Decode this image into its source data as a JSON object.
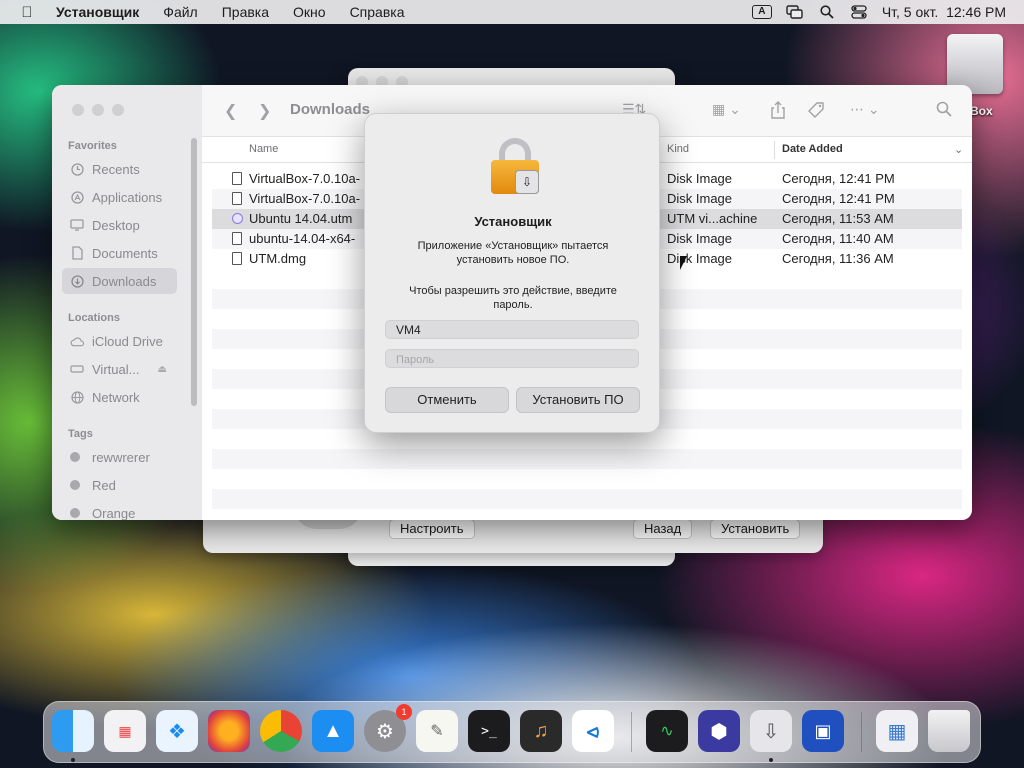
{
  "menubar": {
    "app_name": "Установщик",
    "items": [
      "Файл",
      "Правка",
      "Окно",
      "Справка"
    ],
    "keyboard_indicator": "A",
    "clock": "Чт, 5 окт.  12:46 PM"
  },
  "desktop": {
    "icon_label": "Box"
  },
  "installer_window": {
    "customize_label": "Настроить",
    "back_label": "Назад",
    "install_label": "Установить"
  },
  "finder": {
    "title": "Downloads",
    "sidebar": {
      "favorites_header": "Favorites",
      "favorites": [
        {
          "label": "Recents",
          "icon": "clock-icon"
        },
        {
          "label": "Applications",
          "icon": "applications-icon"
        },
        {
          "label": "Desktop",
          "icon": "desktop-icon"
        },
        {
          "label": "Documents",
          "icon": "document-icon"
        },
        {
          "label": "Downloads",
          "icon": "download-icon"
        }
      ],
      "locations_header": "Locations",
      "locations": [
        {
          "label": "iCloud Drive",
          "icon": "cloud-icon"
        },
        {
          "label": "Virtual...",
          "icon": "disk-icon"
        },
        {
          "label": "Network",
          "icon": "globe-icon"
        }
      ],
      "tags_header": "Tags",
      "tags": [
        {
          "label": "rewwrerer"
        },
        {
          "label": "Red"
        },
        {
          "label": "Orange"
        }
      ]
    },
    "columns": {
      "name": "Name",
      "kind": "Kind",
      "date": "Date Added"
    },
    "rows": [
      {
        "name": "VirtualBox-7.0.10a-",
        "kind": "Disk Image",
        "date": "Сегодня, 12:41 PM"
      },
      {
        "name": "VirtualBox-7.0.10a-",
        "kind": "Disk Image",
        "date": "Сегодня, 12:41 PM"
      },
      {
        "name": "Ubuntu 14.04.utm",
        "kind": "UTM vi...achine",
        "date": "Сегодня, 11:53 AM"
      },
      {
        "name": "ubuntu-14.04-x64-",
        "kind": "Disk Image",
        "date": "Сегодня, 11:40 AM"
      },
      {
        "name": "UTM.dmg",
        "kind": "Disk Image",
        "date": "Сегодня, 11:36 AM"
      }
    ]
  },
  "auth_dialog": {
    "title": "Установщик",
    "message": "Приложение «Установщик» пытается установить новое ПО.",
    "prompt": "Чтобы разрешить это действие, введите пароль.",
    "username_value": "VM4",
    "password_placeholder": "Пароль",
    "cancel_label": "Отменить",
    "confirm_label": "Установить ПО"
  },
  "dock": {
    "notification_badge": "1",
    "terminal_glyph": ">_"
  },
  "colors": {
    "accent": "#0a84ff",
    "selection": "#dcdcdf",
    "lock": "#f0a020"
  }
}
